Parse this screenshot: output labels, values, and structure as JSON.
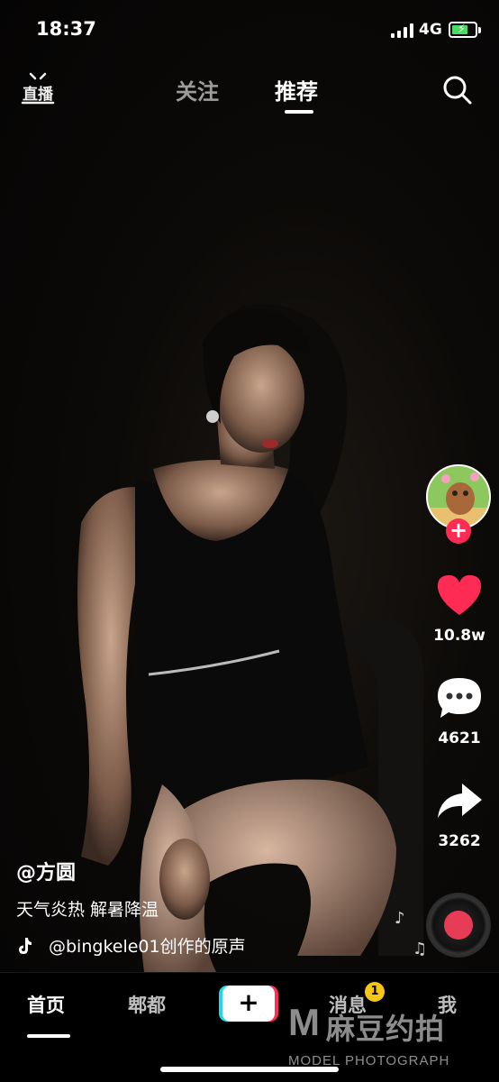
{
  "status_bar": {
    "time": "18:37",
    "network": "4G",
    "battery_level": 0.62
  },
  "top_nav": {
    "live_label": "直播",
    "tabs": [
      {
        "label": "关注",
        "active": false
      },
      {
        "label": "推荐",
        "active": true
      }
    ],
    "search_icon": "search-icon"
  },
  "right_rail": {
    "avatar_follow_symbol": "+",
    "likes": "10.8w",
    "comments": "4621",
    "shares": "3262"
  },
  "caption": {
    "author": "@方圆",
    "text": "天气炎热 解暑降温",
    "sound": "@bingkele01创作的原声"
  },
  "bottom_bar": {
    "tabs": [
      {
        "label": "首页",
        "active": true
      },
      {
        "label": "郫都",
        "active": false
      },
      {
        "label": "消息",
        "active": false
      },
      {
        "label": "我",
        "active": false
      }
    ],
    "create_symbol": "+",
    "message_badge": "1"
  },
  "watermark": {
    "logo": "M",
    "name_cn": "麻豆约拍",
    "name_en": "MODEL PHOTOGRAPH"
  },
  "colors": {
    "accent_pink": "#fe2c55",
    "accent_cyan": "#20d5ec",
    "badge_yellow": "#f5c518",
    "like_red": "#fe2c55"
  }
}
